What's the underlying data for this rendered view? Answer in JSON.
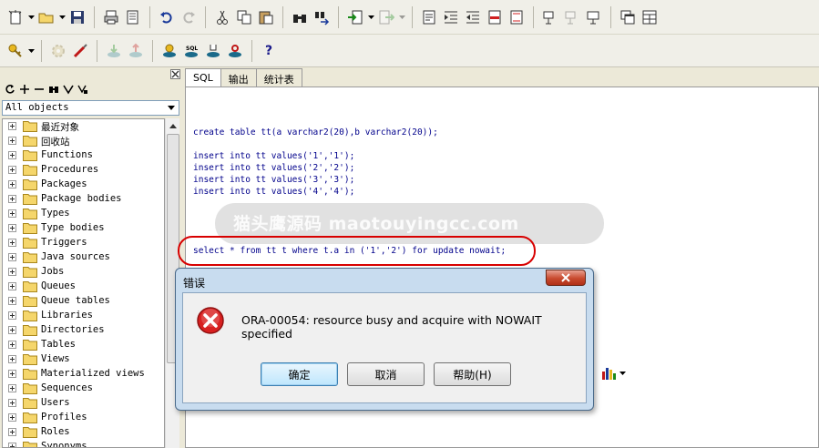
{
  "toolbar1": {
    "icons": [
      "new-icon",
      "open-folder-icon",
      "save-icon",
      "print-icon",
      "print-preview-icon",
      "undo-icon",
      "redo-icon",
      "cut-icon",
      "copy-icon",
      "paste-icon",
      "find-icon",
      "find-replace-icon",
      "import-icon",
      "export-icon",
      "document-icon",
      "indent-icon",
      "unindent-icon",
      "comment-icon",
      "uncomment-icon",
      "tool-a-icon",
      "tool-b-icon",
      "tool-c-icon",
      "windows-icon",
      "layout-icon"
    ]
  },
  "toolbar2": {
    "icons": [
      "key-icon",
      "gear-icon",
      "wand-icon",
      "db-down-icon",
      "db-up-icon",
      "db-execute-icon",
      "sql-icon",
      "db-commit-icon",
      "db-rollback-icon",
      "help-icon"
    ],
    "help_label": "?",
    "sql_label": "SQL"
  },
  "left_panel": {
    "selector_value": "All objects",
    "tree": [
      "最近对象",
      "回收站",
      "Functions",
      "Procedures",
      "Packages",
      "Package bodies",
      "Types",
      "Type bodies",
      "Triggers",
      "Java sources",
      "Jobs",
      "Queues",
      "Queue tables",
      "Libraries",
      "Directories",
      "Tables",
      "Views",
      "Materialized views",
      "Sequences",
      "Users",
      "Profiles",
      "Roles",
      "Synonyms"
    ]
  },
  "editor": {
    "tabs": [
      "SQL",
      "输出",
      "统计表"
    ],
    "lines": {
      "create": "create table tt(a varchar2(20),b varchar2(20));",
      "insert1": "insert into tt values('1','1');",
      "insert2": "insert into tt values('2','2');",
      "insert3": "insert into tt values('3','3');",
      "insert4": "insert into tt values('4','4');",
      "select": "select * from tt t where t.a in ('1','2') for update nowait;"
    },
    "watermark": "猫头鹰源码 maotouyingcc.com",
    "accent_color": "#d80000"
  },
  "dialog": {
    "title": "错误",
    "message": "ORA-00054: resource busy and acquire with NOWAIT specified",
    "buttons": {
      "ok": "确定",
      "cancel": "取消",
      "help": "帮助(H)"
    }
  }
}
